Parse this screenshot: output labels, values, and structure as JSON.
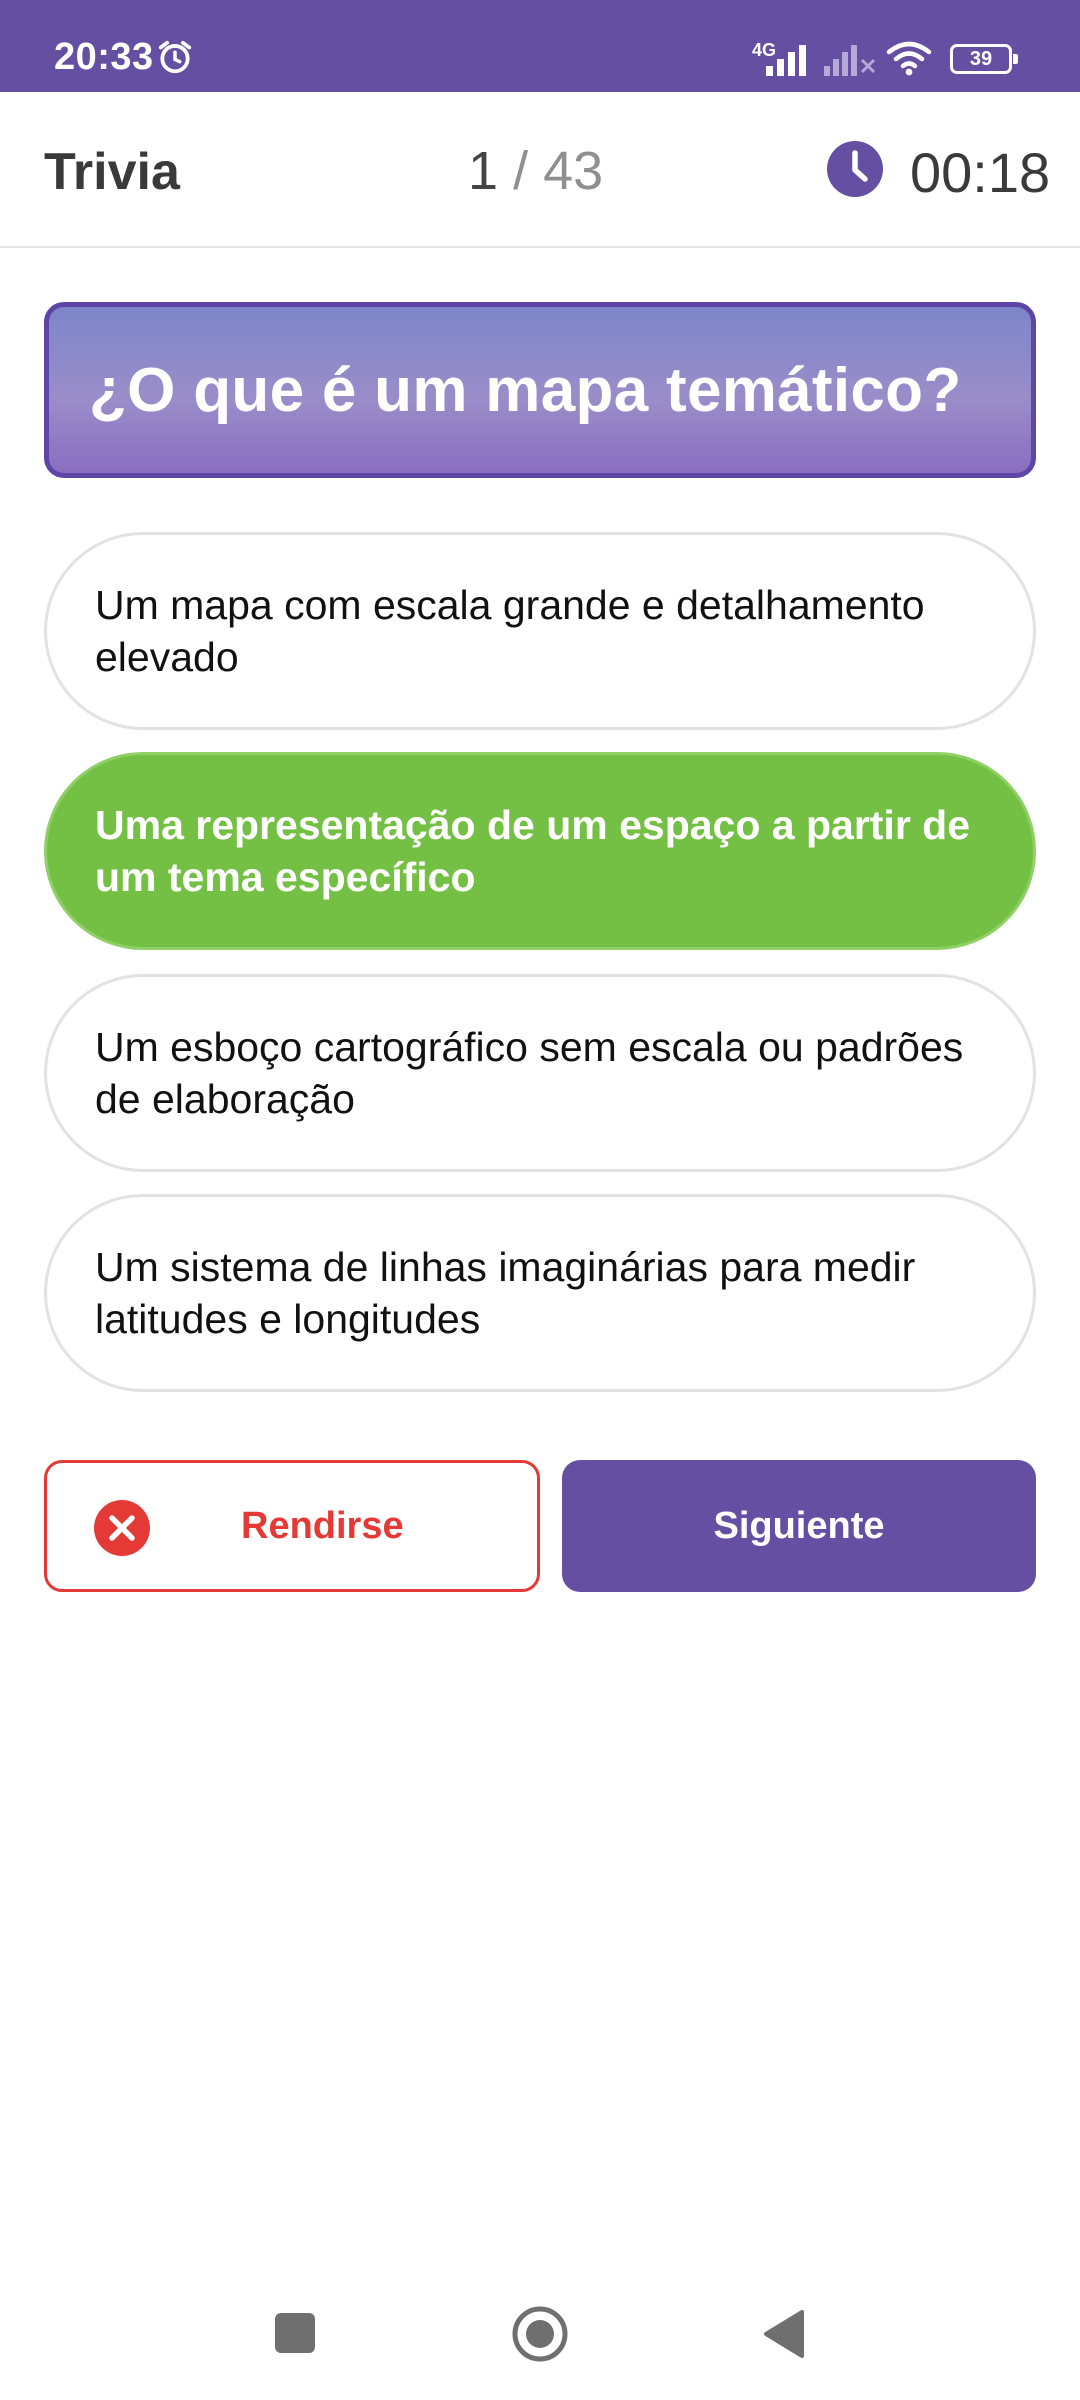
{
  "status_bar": {
    "time": "20:33",
    "network": "4G",
    "battery": "39",
    "icons": [
      "alarm-icon",
      "signal-icon",
      "signal-muted-icon",
      "wifi-icon",
      "battery-icon"
    ]
  },
  "app_bar": {
    "title": "Trivia",
    "question_current": "1",
    "separator": "/",
    "question_total": "43",
    "timer": "00:18",
    "timer_icon": "clock-icon"
  },
  "question": {
    "text": "¿O que é um mapa temático?"
  },
  "options": [
    {
      "text": "Um mapa com escala grande e detalhamento elevado",
      "selected": false
    },
    {
      "text": "Uma representação de um espaço a partir de um tema específico",
      "selected": true
    },
    {
      "text": "Um esboço cartográfico sem escala ou padrões de elaboração",
      "selected": false
    },
    {
      "text": "Um sistema de linhas imaginárias para medir latitudes e longitudes",
      "selected": false
    }
  ],
  "actions": {
    "give_up_label": "Rendirse",
    "give_up_icon": "close-circle-icon",
    "next_label": "Siguiente"
  },
  "nav_bar": {
    "icons": [
      "square-recents-icon",
      "circle-home-icon",
      "triangle-back-icon"
    ]
  },
  "colors": {
    "primary": "#654fa3",
    "selected": "#74c044",
    "danger": "#e53935"
  }
}
